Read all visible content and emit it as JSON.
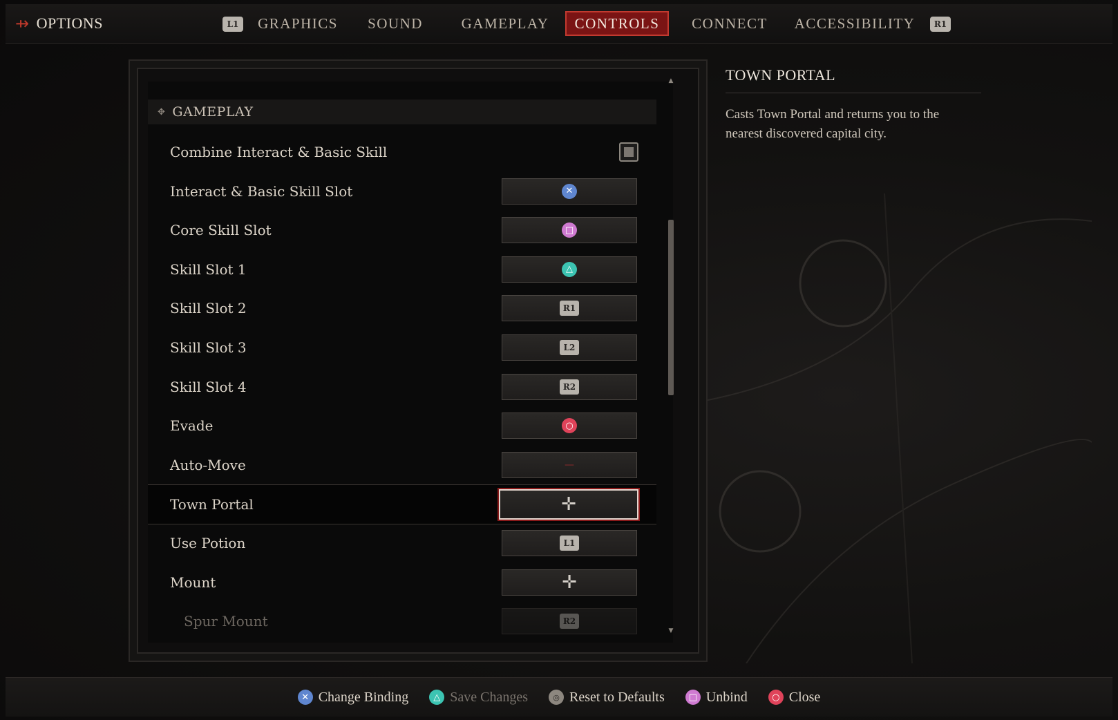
{
  "topbar": {
    "title": "OPTIONS",
    "left_bumper": "L1",
    "right_bumper": "R1",
    "tabs": [
      {
        "label": "GRAPHICS",
        "active": false
      },
      {
        "label": "SOUND",
        "active": false
      },
      {
        "label": "GAMEPLAY",
        "active": false
      },
      {
        "label": "CONTROLS",
        "active": true
      },
      {
        "label": "CONNECT",
        "active": false
      },
      {
        "label": "ACCESSIBILITY",
        "active": false
      }
    ]
  },
  "section": {
    "title": "GAMEPLAY"
  },
  "rows": [
    {
      "label": "Combine Interact & Basic Skill",
      "type": "checkbox",
      "checked": true
    },
    {
      "label": "Interact & Basic Skill Slot",
      "binding": "cross"
    },
    {
      "label": "Core Skill Slot",
      "binding": "square"
    },
    {
      "label": "Skill Slot 1",
      "binding": "triangle"
    },
    {
      "label": "Skill Slot 2",
      "binding": "R1"
    },
    {
      "label": "Skill Slot 3",
      "binding": "L2"
    },
    {
      "label": "Skill Slot 4",
      "binding": "R2"
    },
    {
      "label": "Evade",
      "binding": "circle"
    },
    {
      "label": "Auto-Move",
      "binding": "unbound"
    },
    {
      "label": "Town Portal",
      "binding": "dpad",
      "selected": true
    },
    {
      "label": "Use Potion",
      "binding": "L1"
    },
    {
      "label": "Mount",
      "binding": "dpad"
    },
    {
      "label": "Spur Mount",
      "binding": "R2",
      "sub": true
    }
  ],
  "glyphs": {
    "cross": "✕",
    "square": "□",
    "triangle": "△",
    "circle": "○",
    "dpad": "✛",
    "unbound": "—"
  },
  "description": {
    "title": "TOWN PORTAL",
    "body": "Casts Town Portal and returns you to the nearest discovered capital city."
  },
  "footer": {
    "actions": [
      {
        "glyph": "cross",
        "label": "Change Binding",
        "enabled": true
      },
      {
        "glyph": "triangle",
        "label": "Save Changes",
        "enabled": false
      },
      {
        "glyph": "touchpad",
        "label": "Reset to Defaults",
        "enabled": true
      },
      {
        "glyph": "square",
        "label": "Unbind",
        "enabled": true
      },
      {
        "glyph": "circle",
        "label": "Close",
        "enabled": true
      }
    ]
  },
  "colors": {
    "accent": "#7a1414",
    "accent_border": "#c23a30",
    "cross": "#5f86cf",
    "square": "#cf7ad1",
    "triangle": "#3cc4b2",
    "circle": "#e0435a"
  }
}
